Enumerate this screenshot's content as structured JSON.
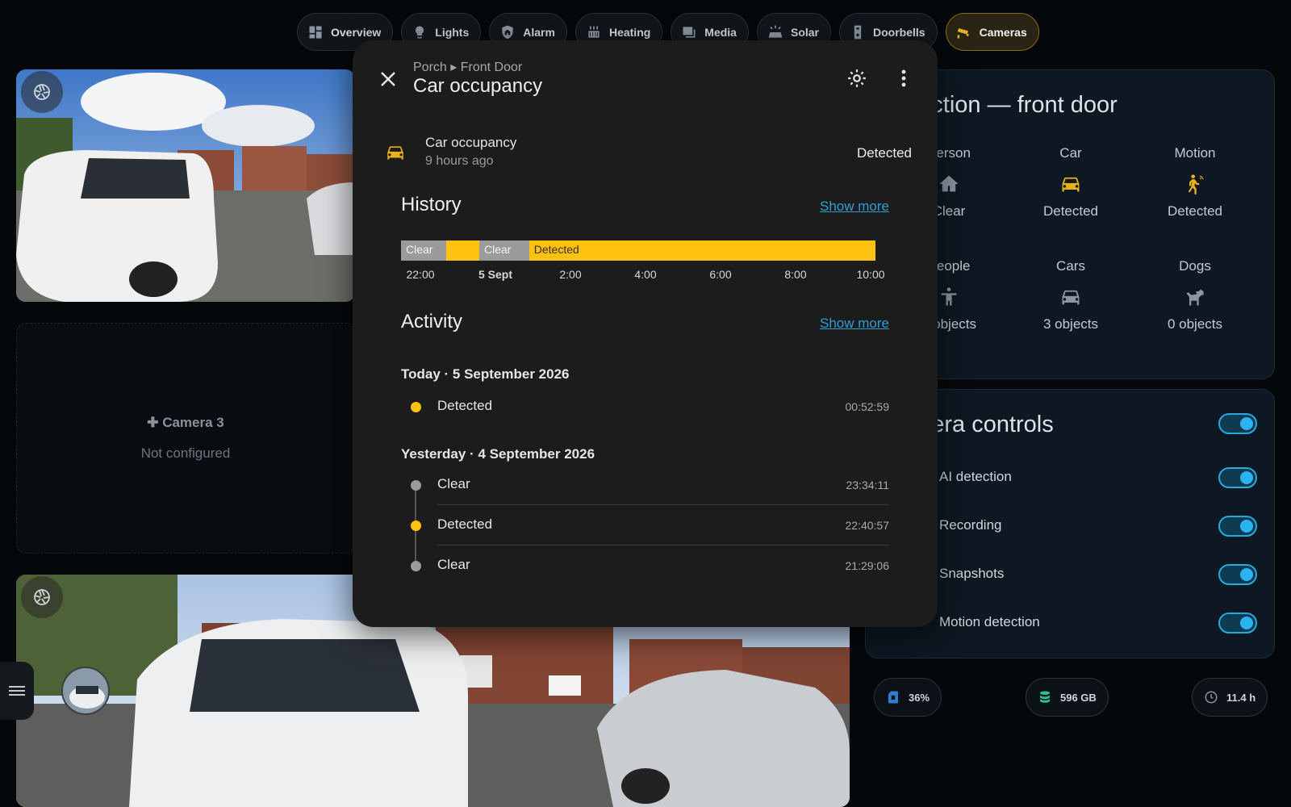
{
  "nav": {
    "tabs": [
      {
        "label": "Overview",
        "icon": "dashboard-icon",
        "active": false
      },
      {
        "label": "Lights",
        "icon": "bulb-icon",
        "active": false
      },
      {
        "label": "Alarm",
        "icon": "shield-home-icon",
        "active": false
      },
      {
        "label": "Heating",
        "icon": "radiator-icon",
        "active": false
      },
      {
        "label": "Media",
        "icon": "media-icon",
        "active": false
      },
      {
        "label": "Solar",
        "icon": "solar-panel-icon",
        "active": false
      },
      {
        "label": "Doorbells",
        "icon": "doorbell-icon",
        "active": false
      },
      {
        "label": "Cameras",
        "icon": "cctv-icon",
        "active": true
      }
    ]
  },
  "cameras": {
    "camera3": {
      "title": "Camera 3",
      "status": "Not configured"
    }
  },
  "detection_card": {
    "title": "Detection — front door",
    "row1": [
      {
        "label": "Person",
        "value": "Clear",
        "icon": "home-icon",
        "highlight": false
      },
      {
        "label": "Car",
        "value": "Detected",
        "icon": "car-icon",
        "highlight": true
      },
      {
        "label": "Motion",
        "value": "Detected",
        "icon": "motion-sensor-icon",
        "highlight": true
      }
    ],
    "row2": [
      {
        "label": "People",
        "value": "0 objects",
        "icon": "human-icon",
        "highlight": false
      },
      {
        "label": "Cars",
        "value": "3 objects",
        "icon": "car-icon",
        "highlight": false
      },
      {
        "label": "Dogs",
        "value": "0 objects",
        "icon": "dog-icon",
        "highlight": false
      }
    ]
  },
  "controls_card": {
    "title": "Camera controls",
    "master_on": true,
    "items": [
      {
        "label": "AI detection",
        "on": true
      },
      {
        "label": "Recording",
        "on": true
      },
      {
        "label": "Snapshots",
        "on": true
      },
      {
        "label": "Motion detection",
        "on": true
      }
    ]
  },
  "stats": {
    "disk": "36%",
    "storage": "596 GB",
    "uptime": "11.4 h"
  },
  "dialog": {
    "breadcrumb": "Porch ▸ Front Door",
    "title": "Car occupancy",
    "entity": {
      "name": "Car occupancy",
      "last_changed": "9 hours ago",
      "state": "Detected"
    },
    "history": {
      "title": "History",
      "show_more": "Show more",
      "segments": [
        {
          "label": "Clear",
          "state": "clear",
          "start": 0.0,
          "end": 0.095
        },
        {
          "label": "",
          "state": "detected",
          "start": 0.095,
          "end": 0.165
        },
        {
          "label": "Clear",
          "state": "clear",
          "start": 0.165,
          "end": 0.27
        },
        {
          "label": "Detected",
          "state": "detected",
          "start": 0.27,
          "end": 1.0
        }
      ],
      "ticks": [
        {
          "label": "22:00",
          "bold": false
        },
        {
          "label": "5 Sept",
          "bold": true
        },
        {
          "label": "2:00",
          "bold": false
        },
        {
          "label": "4:00",
          "bold": false
        },
        {
          "label": "6:00",
          "bold": false
        },
        {
          "label": "8:00",
          "bold": false
        },
        {
          "label": "10:00",
          "bold": false
        }
      ]
    },
    "activity": {
      "title": "Activity",
      "show_more": "Show more",
      "today": {
        "heading": "Today · 5 September 2026",
        "events": [
          {
            "state": "Detected",
            "time": "00:52:59"
          }
        ]
      },
      "yesterday": {
        "heading": "Yesterday · 4 September 2026",
        "events": [
          {
            "state": "Clear",
            "time": "23:34:11"
          },
          {
            "state": "Detected",
            "time": "22:40:57"
          },
          {
            "state": "Clear",
            "time": "21:29:06"
          }
        ]
      }
    }
  },
  "colors": {
    "detected": "#fdc10f",
    "clear": "#9b9b9b",
    "accent": "#2aa7e0"
  }
}
